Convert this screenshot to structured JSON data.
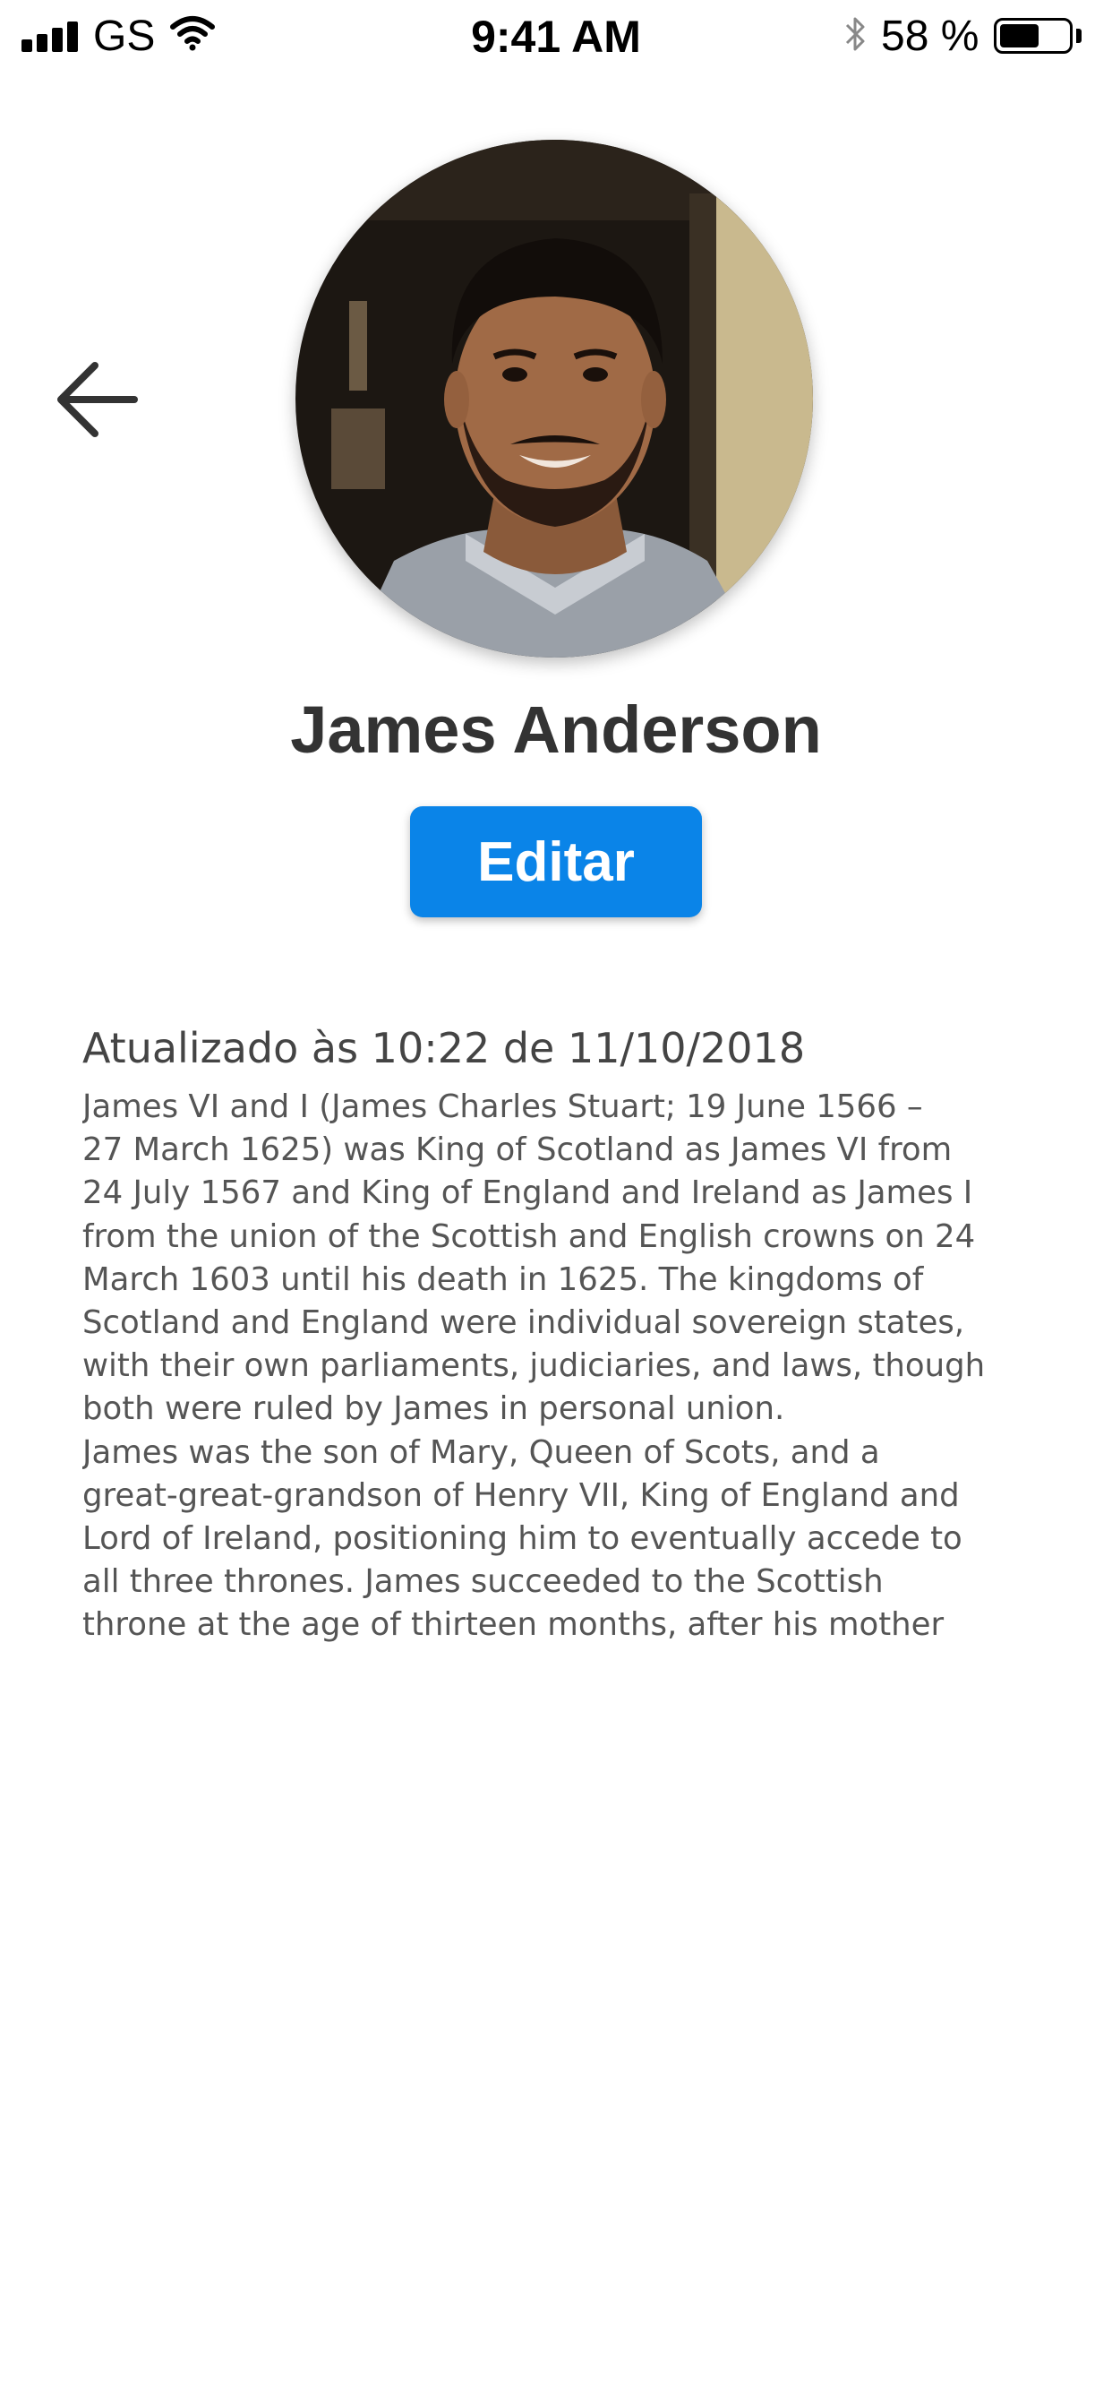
{
  "status_bar": {
    "carrier": "GS",
    "time": "9:41 AM",
    "battery_percent_label": "58 %",
    "battery_level": 0.58
  },
  "header": {
    "back_icon": "arrow-left-icon"
  },
  "profile": {
    "name": "James Anderson",
    "edit_label": "Editar",
    "avatar_icon": "profile-photo"
  },
  "content": {
    "updated_label": "Atualizado às 10:22 de 11/10/2018",
    "bio": "James VI and I (James Charles Stuart; 19 June 1566 –\n27 March 1625) was King of Scotland as James VI from\n24 July 1567 and King of England and Ireland as James I\nfrom the union of the Scottish and English crowns on 24\nMarch 1603 until his death in 1625. The kingdoms of\nScotland and England were individual sovereign states,\nwith their own parliaments, judiciaries, and laws, though\nboth were ruled by James in personal union.\nJames was the son of Mary, Queen of Scots, and a\ngreat-great-grandson of Henry VII, King of England and\nLord of Ireland, positioning him to eventually accede to\nall three thrones. James succeeded to the Scottish\nthrone at the age of thirteen months, after his mother"
  },
  "colors": {
    "accent": "#0a84e8",
    "name_text": "#333333",
    "body_text": "#555555"
  }
}
